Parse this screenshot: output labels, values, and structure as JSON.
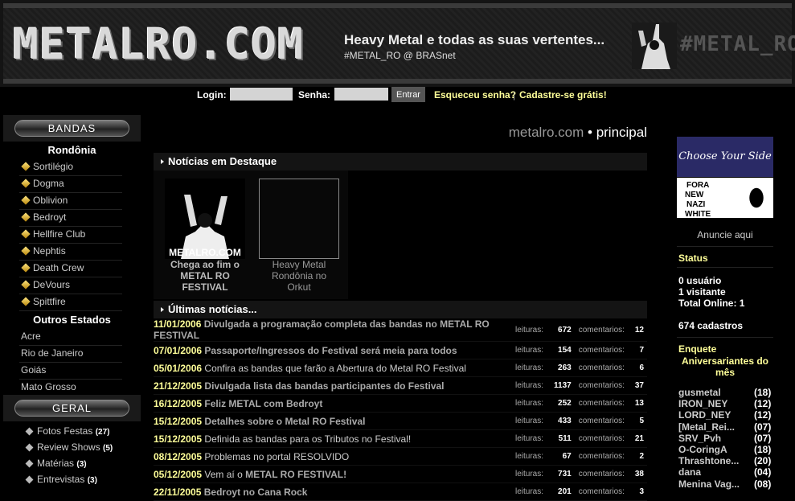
{
  "header": {
    "logo": "METALRO.COM",
    "tagline": "Heavy Metal e todas as suas vertentes...",
    "subtagline": "#METAL_RO @ BRASnet",
    "channel": "#METAL_RO"
  },
  "login": {
    "login_label": "Login:",
    "senha_label": "Senha:",
    "login_value": "",
    "senha_value": "",
    "button": "Entrar",
    "forgot": "Esqueceu senha?",
    "separator": "|",
    "register": "Cadastre-se grátis!"
  },
  "sidebar": {
    "bandas_title": "BANDAS",
    "rondonia_title": "Rondônia",
    "rondonia_bands": [
      "Sortilégio",
      "Dogma",
      "Oblivion",
      "Bedroyt",
      "Hellfire Club",
      "Nephtis",
      "Death Crew",
      "DeVours",
      "Spittfire"
    ],
    "outros_title": "Outros Estados",
    "outros": [
      "Acre",
      "Rio de Janeiro",
      "Goiás",
      "Mato Grosso"
    ],
    "geral_title": "GERAL",
    "geral": [
      {
        "label": "Fotos Festas",
        "count": "(27)"
      },
      {
        "label": "Review Shows",
        "count": "(5)"
      },
      {
        "label": "Matérias",
        "count": "(3)"
      },
      {
        "label": "Entrevistas",
        "count": "(3)"
      }
    ]
  },
  "main": {
    "breadcrumb_site": "metalro.com",
    "breadcrumb_sep": " • ",
    "breadcrumb_page": "principal",
    "destaque_title": "Notícias em Destaque",
    "destaque": [
      {
        "image_text": "METALRO.COM",
        "caption": "Chega ao fim o METAL RO FESTIVAL"
      },
      {
        "caption": "Heavy Metal Rondônia no Orkut"
      }
    ],
    "ultimas_title": "Últimas notícias...",
    "leituras_label": "leituras:",
    "comentarios_label": "comentarios:",
    "news": [
      {
        "date": "11/01/2006",
        "title": "Divulgada a programação completa das bandas no METAL RO FESTIVAL",
        "bold": true,
        "reads": "672",
        "comments": "12"
      },
      {
        "date": "07/01/2006",
        "title": "Passaporte/Ingressos do Festival será meia para todos",
        "bold": true,
        "reads": "154",
        "comments": "7"
      },
      {
        "date": "05/01/2006",
        "title": "Confira as bandas que farão a Abertura do Metal RO Festival",
        "bold": false,
        "reads": "263",
        "comments": "6"
      },
      {
        "date": "21/12/2005",
        "title": "Divulgada lista das bandas participantes do Festival",
        "bold": true,
        "reads": "1137",
        "comments": "37"
      },
      {
        "date": "16/12/2005",
        "title": "Feliz METAL com Bedroyt",
        "bold": true,
        "reads": "252",
        "comments": "13"
      },
      {
        "date": "15/12/2005",
        "title": "Detalhes sobre o Metal RO Festival",
        "bold": true,
        "reads": "433",
        "comments": "5"
      },
      {
        "date": "15/12/2005",
        "title": "Definida as bandas para os Tributos no Festival!",
        "bold": false,
        "reads": "511",
        "comments": "21"
      },
      {
        "date": "08/12/2005",
        "title": "Problemas no portal RESOLVIDO",
        "bold": false,
        "reads": "67",
        "comments": "2"
      },
      {
        "date": "05/12/2005",
        "title_pre": "Vem aí o ",
        "title": "METAL RO FESTIVAL!",
        "bold": true,
        "reads": "731",
        "comments": "38"
      },
      {
        "date": "22/11/2005",
        "title": "Bedroyt no Cana Rock",
        "bold": true,
        "reads": "201",
        "comments": "3"
      }
    ]
  },
  "right": {
    "ad1": "Choose Your Side",
    "ad2_lines": [
      "FORA",
      "NEW",
      "NAZI",
      "WHITE"
    ],
    "anuncie": "Anuncie aqui",
    "status_title": "Status",
    "usuarios": "0 usuário",
    "visitantes": "1 visitante",
    "total_online": "Total Online: 1",
    "cadastros": "674 cadastros",
    "enquete": "Enquete",
    "aniversariantes": "Aniversariantes do mês",
    "birthdays": [
      {
        "name": "gusmetal",
        "age": "(18)"
      },
      {
        "name": "IRON_NEY",
        "age": "(12)"
      },
      {
        "name": "LORD_NEY",
        "age": "(12)"
      },
      {
        "name": "[Metal_Rei...",
        "age": "(07)"
      },
      {
        "name": "SRV_Pvh",
        "age": "(07)"
      },
      {
        "name": "O-CoringA",
        "age": "(18)"
      },
      {
        "name": "Thrashtone...",
        "age": "(20)"
      },
      {
        "name": "dana",
        "age": "(04)"
      },
      {
        "name": "Menina Vag...",
        "age": "(08)"
      }
    ]
  }
}
